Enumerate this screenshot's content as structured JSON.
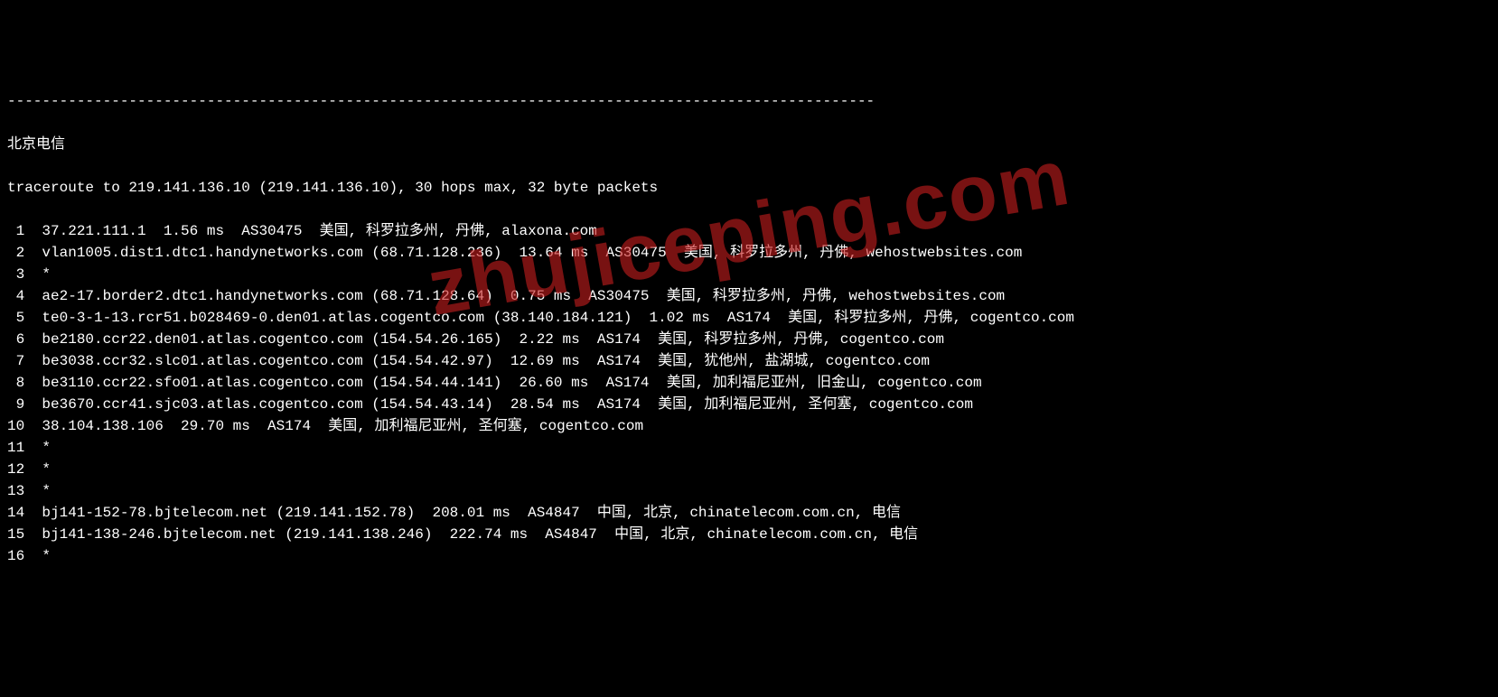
{
  "separator": "----------------------------------------------------------------------------------------------------",
  "title": "北京电信",
  "traceroute_header": "traceroute to 219.141.136.10 (219.141.136.10), 30 hops max, 32 byte packets",
  "watermark": "zhujiceping.com",
  "hops": [
    {
      "num": "1",
      "text": "37.221.111.1  1.56 ms  AS30475  美国, 科罗拉多州, 丹佛, alaxona.com"
    },
    {
      "num": "2",
      "text": "vlan1005.dist1.dtc1.handynetworks.com (68.71.128.236)  13.64 ms  AS30475  美国, 科罗拉多州, 丹佛, wehostwebsites.com"
    },
    {
      "num": "3",
      "text": "*"
    },
    {
      "num": "4",
      "text": "ae2-17.border2.dtc1.handynetworks.com (68.71.128.64)  0.75 ms  AS30475  美国, 科罗拉多州, 丹佛, wehostwebsites.com"
    },
    {
      "num": "5",
      "text": "te0-3-1-13.rcr51.b028469-0.den01.atlas.cogentco.com (38.140.184.121)  1.02 ms  AS174  美国, 科罗拉多州, 丹佛, cogentco.com"
    },
    {
      "num": "6",
      "text": "be2180.ccr22.den01.atlas.cogentco.com (154.54.26.165)  2.22 ms  AS174  美国, 科罗拉多州, 丹佛, cogentco.com"
    },
    {
      "num": "7",
      "text": "be3038.ccr32.slc01.atlas.cogentco.com (154.54.42.97)  12.69 ms  AS174  美国, 犹他州, 盐湖城, cogentco.com"
    },
    {
      "num": "8",
      "text": "be3110.ccr22.sfo01.atlas.cogentco.com (154.54.44.141)  26.60 ms  AS174  美国, 加利福尼亚州, 旧金山, cogentco.com"
    },
    {
      "num": "9",
      "text": "be3670.ccr41.sjc03.atlas.cogentco.com (154.54.43.14)  28.54 ms  AS174  美国, 加利福尼亚州, 圣何塞, cogentco.com"
    },
    {
      "num": "10",
      "text": "38.104.138.106  29.70 ms  AS174  美国, 加利福尼亚州, 圣何塞, cogentco.com"
    },
    {
      "num": "11",
      "text": "*"
    },
    {
      "num": "12",
      "text": "*"
    },
    {
      "num": "13",
      "text": "*"
    },
    {
      "num": "14",
      "text": "bj141-152-78.bjtelecom.net (219.141.152.78)  208.01 ms  AS4847  中国, 北京, chinatelecom.com.cn, 电信"
    },
    {
      "num": "15",
      "text": "bj141-138-246.bjtelecom.net (219.141.138.246)  222.74 ms  AS4847  中国, 北京, chinatelecom.com.cn, 电信"
    },
    {
      "num": "16",
      "text": "*"
    }
  ]
}
